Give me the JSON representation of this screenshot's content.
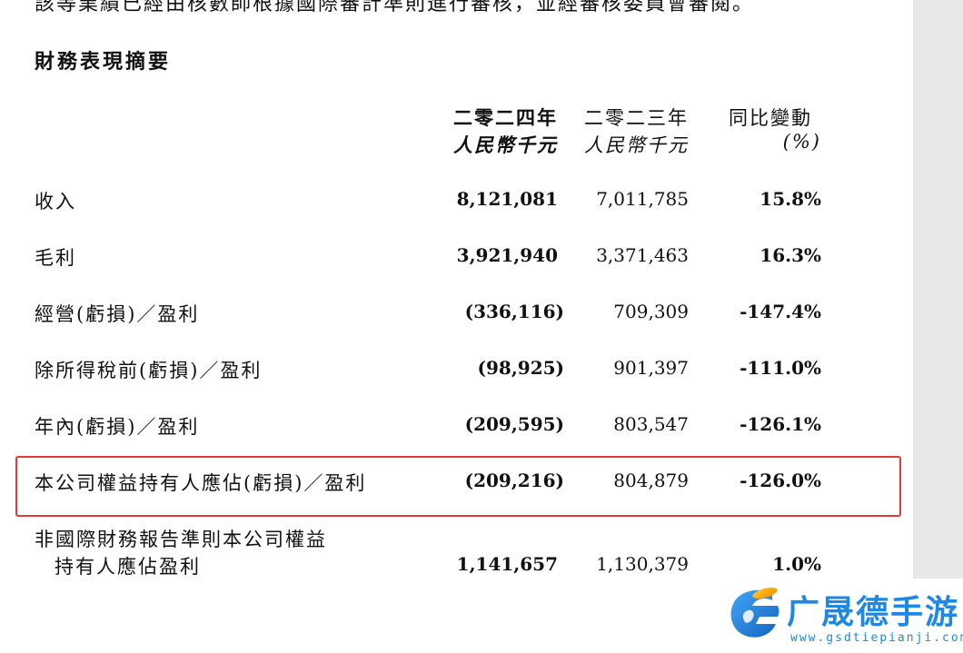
{
  "document": {
    "top_text_partial": "該等業績已經由核數師根據國際審計準則進行審核，並經審核委員會審閱。",
    "section_title": "財務表現摘要"
  },
  "table": {
    "headers": {
      "y2024_line1": "二零二四年",
      "y2024_line2": "人民幣千元",
      "y2023_line1": "二零二三年",
      "y2023_line2": "人民幣千元",
      "yoy_line1": "同比變動",
      "yoy_line2": "(%)"
    },
    "rows": [
      {
        "label": "收入",
        "y2024": "8,121,081",
        "y2023": "7,011,785",
        "yoy": "15.8%"
      },
      {
        "label": "毛利",
        "y2024": "3,921,940",
        "y2023": "3,371,463",
        "yoy": "16.3%"
      },
      {
        "label": "經營(虧損)／盈利",
        "y2024": "(336,116)",
        "y2023": "709,309",
        "yoy": "-147.4%"
      },
      {
        "label": "除所得稅前(虧損)／盈利",
        "y2024": "(98,925)",
        "y2023": "901,397",
        "yoy": "-111.0%"
      },
      {
        "label": "年內(虧損)／盈利",
        "y2024": "(209,595)",
        "y2023": "803,547",
        "yoy": "-126.1%"
      },
      {
        "label": "本公司權益持有人應佔(虧損)／盈利",
        "y2024": "(209,216)",
        "y2023": "804,879",
        "yoy": "-126.0%"
      },
      {
        "label_line1": "非國際財務報告準則本公司權益",
        "label_line2": "持有人應佔盈利",
        "y2024": "1,141,657",
        "y2023": "1,130,379",
        "yoy": "1.0%"
      }
    ]
  },
  "watermark": {
    "name": "广晟德手游",
    "url": "www.gsdtiepianji.com",
    "color": "#1e88e5"
  },
  "colors": {
    "highlight_border": "#e53935",
    "margin_gray": "#e8e8e8"
  }
}
